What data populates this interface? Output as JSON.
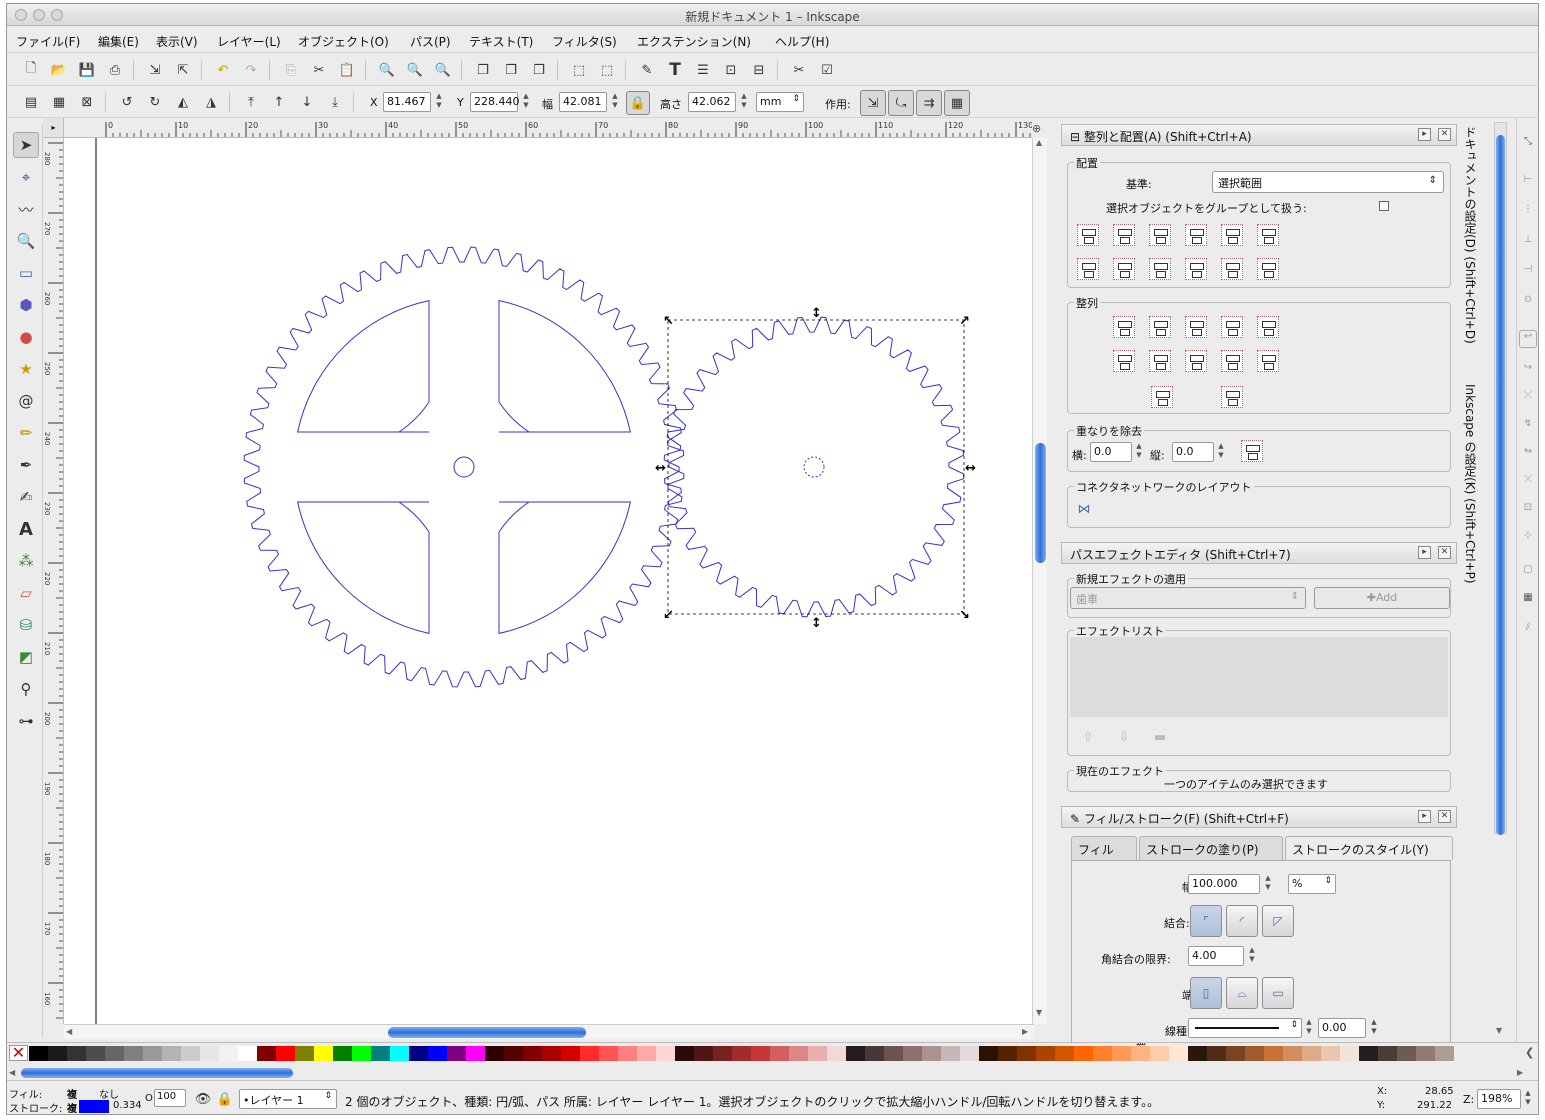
{
  "window": {
    "title": "新規ドキュメント 1 – Inkscape"
  },
  "menu": [
    "ファイル(F)",
    "編集(E)",
    "表示(V)",
    "レイヤー(L)",
    "オブジェクト(O)",
    "パス(P)",
    "テキスト(T)",
    "フィルタ(S)",
    "エクステンション(N)",
    "ヘルプ(H)"
  ],
  "select_toolbar": {
    "x_label": "X",
    "x_value": "81.467",
    "y_label": "Y",
    "y_value": "228.440",
    "w_label": "幅",
    "w_value": "42.081",
    "h_label": "高さ",
    "h_value": "42.062",
    "unit": "mm",
    "affect_label": "作用:"
  },
  "ruler": {
    "h_ticks": [
      "0",
      "10",
      "20",
      "30",
      "40",
      "50",
      "60",
      "70",
      "80",
      "90",
      "100",
      "110",
      "120",
      "130"
    ],
    "v_ticks": [
      "280",
      "270",
      "260",
      "250",
      "240",
      "230",
      "220",
      "210",
      "200",
      "190",
      "180",
      "170",
      "160"
    ]
  },
  "align_panel": {
    "title": "整列と配置(A) (Shift+Ctrl+A)",
    "section_align": "配置",
    "relative_label": "基準:",
    "relative_value": "選択範囲",
    "group_label": "選択オブジェクトをグループとして扱う:",
    "section_distribute": "整列",
    "section_overlap": "重なりを除去",
    "h_label": "横:",
    "h_value": "0.0",
    "v_label": "縦:",
    "v_value": "0.0",
    "section_connector": "コネクタネットワークのレイアウト"
  },
  "lpe_panel": {
    "title": "パスエフェクトエディタ (Shift+Ctrl+7)",
    "apply_label": "新規エフェクトの適用",
    "effect_value": "歯車",
    "add_label": "Add",
    "list_label": "エフェクトリスト",
    "current_label": "現在のエフェクト",
    "current_value": "一つのアイテムのみ選択できます"
  },
  "fill_stroke_panel": {
    "title": "フィル/ストローク(F) (Shift+Ctrl+F)",
    "tabs": [
      "フィル",
      "ストロークの塗り(P)",
      "ストロークのスタイル(Y)"
    ],
    "width_label": "幅:",
    "width_value": "100.000",
    "width_unit": "%",
    "join_label": "結合:",
    "miter_label": "角結合の限界:",
    "miter_value": "4.00",
    "cap_label": "端:",
    "dash_label": "線種:",
    "dash_value": "0.00",
    "end_label": "端"
  },
  "side_tabs": [
    "ドキュメントの設定(D) (Shift+Ctrl+D)",
    "Inkscape の設定(K) (Shift+Ctrl+P)"
  ],
  "status": {
    "fill_label": "フィル:",
    "fill_value": "複",
    "stroke_label": "ストローク:",
    "stroke_value": "複",
    "none_label": "なし",
    "stroke_width": "0.334",
    "opacity_label": "O:",
    "opacity_value": "100",
    "layer": "•レイヤー 1",
    "message": "2 個のオブジェクト、種類: 円/弧、パス 所属: レイヤー レイヤー 1。選択オブジェクトのクリックで拡大縮小ハンドル/回転ハンドルを切り替えます。。",
    "x_label": "X:",
    "x_value": "28.65",
    "y_label": "Y:",
    "y_value": "291.22",
    "zoom_label": "Z:",
    "zoom_value": "198%"
  },
  "colors": {
    "gear_stroke": "#3333cc",
    "accent": "#3d7be0"
  },
  "palette": [
    "#000000",
    "#1a1a1a",
    "#333333",
    "#4d4d4d",
    "#666666",
    "#808080",
    "#999999",
    "#b3b3b3",
    "#cccccc",
    "#e6e6e6",
    "#f2f2f2",
    "#ffffff",
    "#800000",
    "#ff0000",
    "#808000",
    "#ffff00",
    "#008000",
    "#00ff00",
    "#008080",
    "#00ffff",
    "#000080",
    "#0000ff",
    "#800080",
    "#ff00ff",
    "#2b0000",
    "#550000",
    "#800000",
    "#aa0000",
    "#d40000",
    "#ff2a2a",
    "#ff5555",
    "#ff8080",
    "#ffaaaa",
    "#ffd5d5",
    "#280b0b",
    "#501616",
    "#782121",
    "#a02c2c",
    "#c83737",
    "#d35f5f",
    "#de8787",
    "#e9afaf",
    "#f4d7d7",
    "#241c1c",
    "#483737",
    "#6c5353",
    "#916f6f",
    "#ac9393",
    "#c8b7b7",
    "#e3dbdb",
    "#2b1100",
    "#552200",
    "#803300",
    "#aa4400",
    "#d45500",
    "#ff6600",
    "#ff7f2a",
    "#ff9955",
    "#ffb380",
    "#ffccaa",
    "#ffe6d5",
    "#28170b",
    "#502d16",
    "#784421",
    "#a05a2c",
    "#c87137",
    "#d38d5f",
    "#deaa87",
    "#e9c6af",
    "#f4e3d7",
    "#241f1c",
    "#483e37",
    "#6c5d53",
    "#917c6f",
    "#ac9d93"
  ]
}
